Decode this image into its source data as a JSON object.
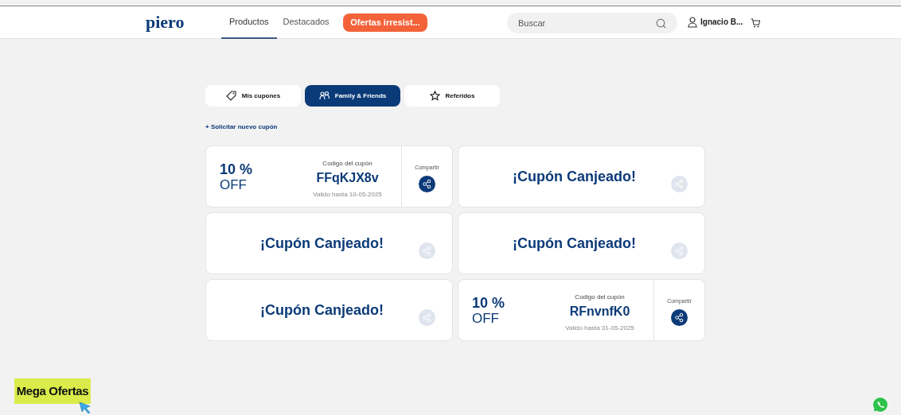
{
  "header": {
    "logo": "piero",
    "nav": [
      {
        "label": "Productos",
        "selected": true
      },
      {
        "label": "Destacados",
        "selected": false
      }
    ],
    "promo_button": "Ofertas irresist...",
    "search": {
      "placeholder": "Buscar"
    },
    "user": "Ignacio B..."
  },
  "tabs": [
    {
      "label": "Mis cupones",
      "selected": false
    },
    {
      "label": "Family & Friends",
      "selected": true
    },
    {
      "label": "Referidos",
      "selected": false
    }
  ],
  "request_link": "+ Solicitar nuevo cupón",
  "coupons": [
    {
      "percent": "10 %",
      "off": "OFF",
      "code_label": "Codigo del cupón",
      "code": "FFqKJX8v",
      "valid": "Valido hasta 10-05-2025",
      "share_label": "Compartir",
      "redeemed": false
    },
    {
      "redeemed": true,
      "redeemed_label": "¡Cupón Canjeado!"
    },
    {
      "redeemed": true,
      "redeemed_label": "¡Cupón Canjeado!"
    },
    {
      "redeemed": true,
      "redeemed_label": "¡Cupón Canjeado!"
    },
    {
      "redeemed": true,
      "redeemed_label": "¡Cupón Canjeado!"
    },
    {
      "percent": "10 %",
      "off": "OFF",
      "code_label": "Codigo del cupón",
      "code": "RFnvnfK0",
      "valid": "Valido hasta 31-05-2025",
      "share_label": "Compartir",
      "redeemed": false
    }
  ],
  "mega_badge": "Mega Ofertas"
}
